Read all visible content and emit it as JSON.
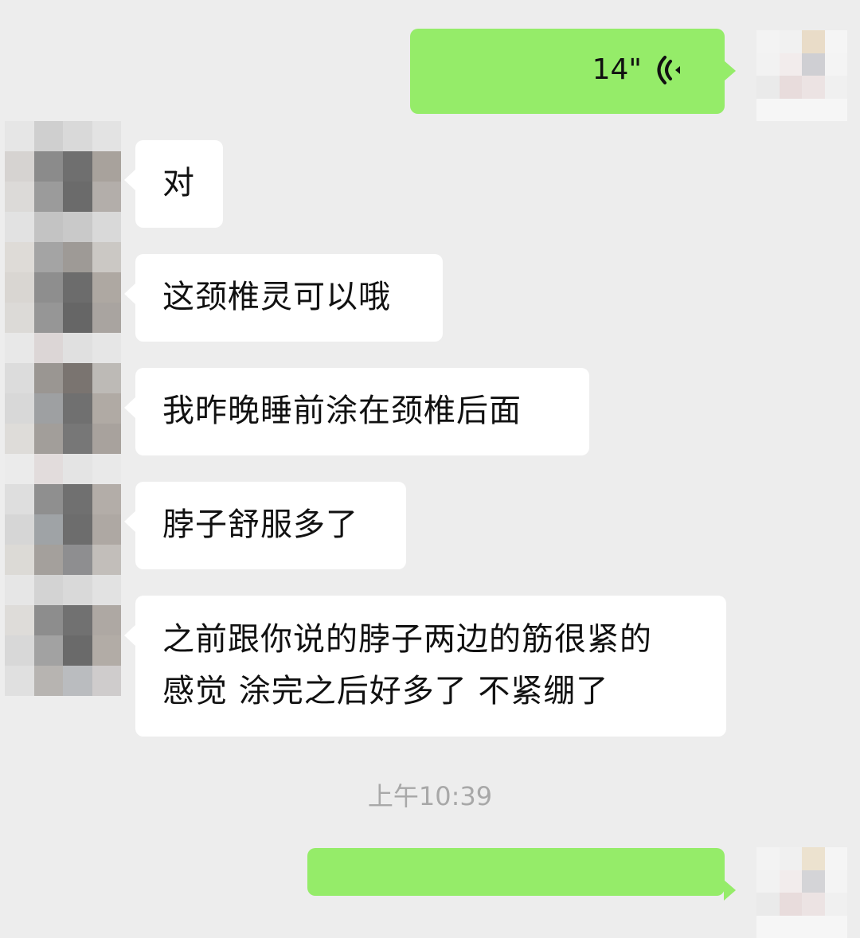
{
  "conversation": {
    "voice_message": {
      "duration": "14\""
    },
    "incoming_messages": [
      {
        "text": "对"
      },
      {
        "text": "这颈椎灵可以哦"
      },
      {
        "text": "我昨晚睡前涂在颈椎后面"
      },
      {
        "text": "脖子舒服多了"
      },
      {
        "line1": "之前跟你说的脖子两边的筋很紧的",
        "line2": "感觉 涂完之后好多了 不紧绷了"
      }
    ],
    "time_divider": "上午10:39"
  },
  "colors": {
    "background": "#ededed",
    "incoming_bubble": "#ffffff",
    "outgoing_bubble": "#95ec69",
    "timestamp_text": "#a8a8a8"
  }
}
